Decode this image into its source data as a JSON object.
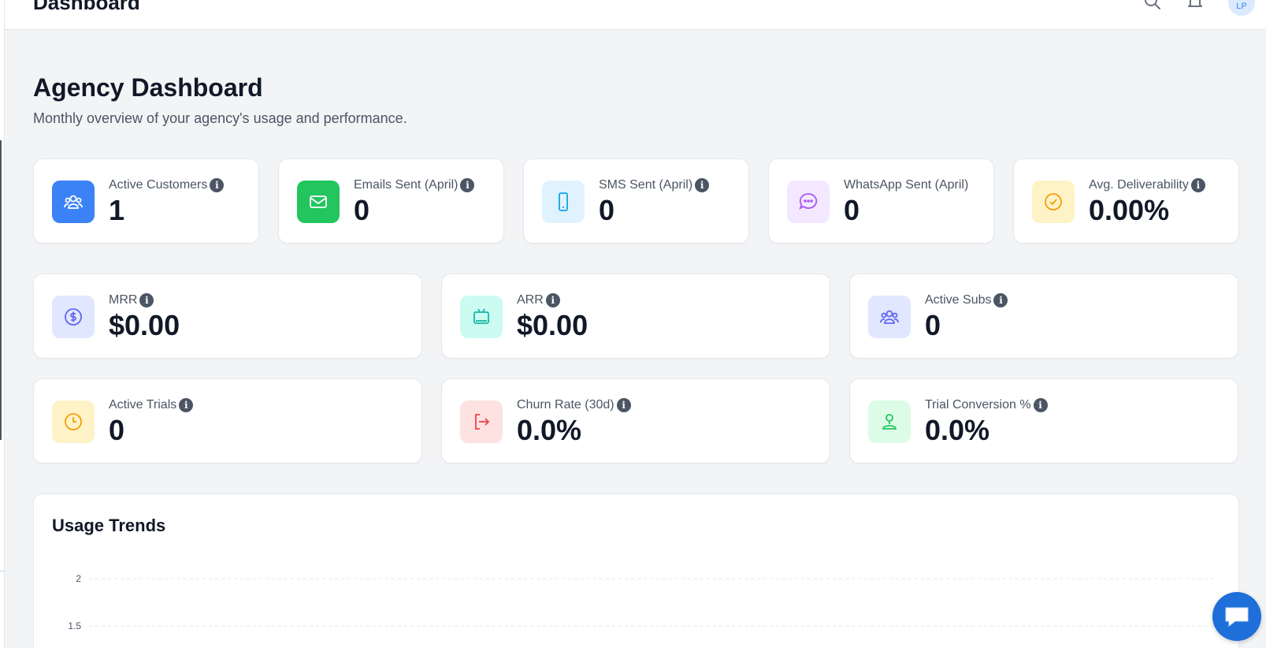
{
  "header": {
    "title": "Dashboard",
    "avatar_initials": "LP"
  },
  "page": {
    "title": "Agency Dashboard",
    "subtitle": "Monthly overview of your agency's usage and performance."
  },
  "stats_row1": [
    {
      "label": "Active Customers",
      "value": "1",
      "icon": "users-icon",
      "icon_bg": "#3b82f6",
      "icon_color": "#ffffff",
      "info": true
    },
    {
      "label": "Emails Sent (April)",
      "value": "0",
      "icon": "mail-icon",
      "icon_bg": "#22c55e",
      "icon_color": "#ffffff",
      "info": true
    },
    {
      "label": "SMS Sent (April)",
      "value": "0",
      "icon": "phone-icon",
      "icon_bg": "#e0f2fe",
      "icon_color": "#0ea5e9",
      "info": true
    },
    {
      "label": "WhatsApp Sent (April)",
      "value": "0",
      "icon": "chat-bubble-icon",
      "icon_bg": "#f3e8ff",
      "icon_color": "#a855f7",
      "info": false
    },
    {
      "label": "Avg. Deliverability",
      "value": "0.00%",
      "icon": "check-circle-icon",
      "icon_bg": "#fef3c7",
      "icon_color": "#f59e0b",
      "info": true
    }
  ],
  "stats_row2": [
    {
      "label": "MRR",
      "value": "$0.00",
      "icon": "dollar-circle-icon",
      "icon_bg": "#e0e7ff",
      "icon_color": "#6366f1"
    },
    {
      "label": "ARR",
      "value": "$0.00",
      "icon": "tv-icon",
      "icon_bg": "#ccfbf1",
      "icon_color": "#14b8a6"
    },
    {
      "label": "Active Subs",
      "value": "0",
      "icon": "users-icon",
      "icon_bg": "#e0e7ff",
      "icon_color": "#6366f1"
    }
  ],
  "stats_row3": [
    {
      "label": "Active Trials",
      "value": "0",
      "icon": "clock-icon",
      "icon_bg": "#fef3c7",
      "icon_color": "#f59e0b"
    },
    {
      "label": "Churn Rate (30d)",
      "value": "0.0%",
      "icon": "logout-icon",
      "icon_bg": "#fee2e2",
      "icon_color": "#ef4444"
    },
    {
      "label": "Trial Conversion %",
      "value": "0.0%",
      "icon": "user-pin-icon",
      "icon_bg": "#dcfce7",
      "icon_color": "#22c55e"
    }
  ],
  "usage_chart": {
    "title": "Usage Trends"
  },
  "chart_data": {
    "type": "line",
    "title": "Usage Trends",
    "y_ticks": [
      "2",
      "1.5"
    ],
    "ylim": [
      0,
      2
    ],
    "grid": true,
    "series": []
  },
  "colors": {
    "accent": "#3b82f6",
    "chat_button": "#1e6fd9"
  }
}
